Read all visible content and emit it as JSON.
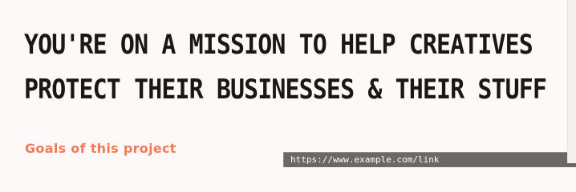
{
  "headline": {
    "line1": "You're on a mission To help creatives",
    "line2": "protect their businesses & their stuff"
  },
  "section": {
    "label": "Goals of this project"
  },
  "tooltip": {
    "text": "https://www.example.com/link"
  },
  "colors": {
    "background": "#fdf9f8",
    "headline": "#1a1717",
    "accent": "#f07b5a",
    "tooltip_bg": "#6b6867"
  }
}
